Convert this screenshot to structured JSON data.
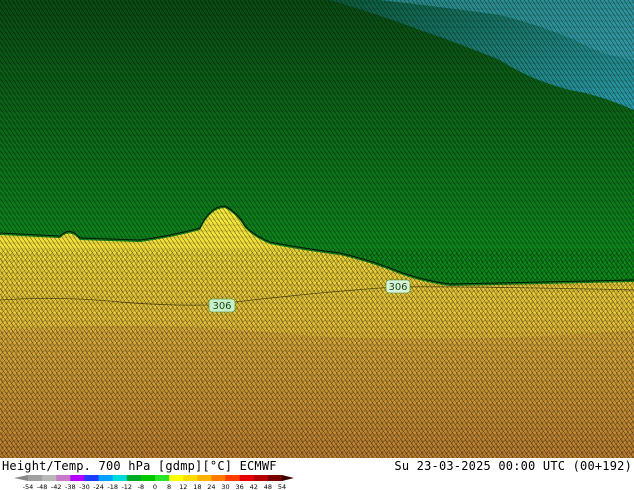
{
  "map": {
    "contour_labels": [
      "306",
      "306"
    ]
  },
  "footer": {
    "left_text": "Height/Temp. 700 hPa [gdmp][°C] ECMWF",
    "right_text": "Su 23-03-2025 00:00 UTC (00+192)"
  },
  "colorbar": {
    "ticks": [
      "-54",
      "-48",
      "-42",
      "-38",
      "-30",
      "-24",
      "-18",
      "-12",
      "-8",
      "0",
      "8",
      "12",
      "18",
      "24",
      "30",
      "36",
      "42",
      "48",
      "54"
    ],
    "colors": [
      "#a0a0a0",
      "#b8b8b8",
      "#c878c8",
      "#b400ff",
      "#1e3cff",
      "#00a0ff",
      "#00dcdc",
      "#00aa28",
      "#00c800",
      "#28e628",
      "#ffff00",
      "#ffdc00",
      "#ffb400",
      "#ff7800",
      "#ff3c00",
      "#e60000",
      "#b40000",
      "#780000"
    ]
  }
}
